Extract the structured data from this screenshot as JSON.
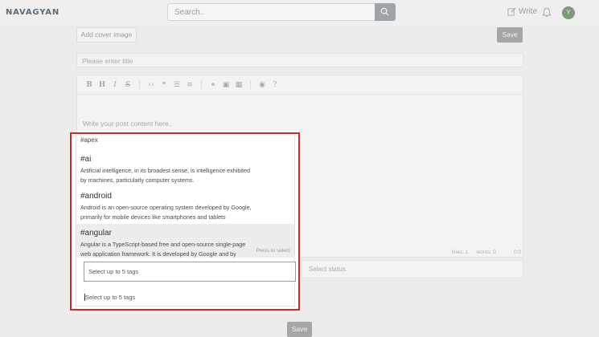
{
  "header": {
    "logo_text": "NAVAGYAN",
    "search_placeholder": "Search..",
    "write_label": "Write",
    "avatar_initial": "Y"
  },
  "editor": {
    "cover_button": "Add cover image",
    "save_top": "Save",
    "title_placeholder": "Please enter title",
    "content_placeholder": "Write your post content here..",
    "status": {
      "lines": "lines: 1",
      "words": "words: 0",
      "cursor": "0:0"
    },
    "status_select_placeholder": "Select status",
    "save_bottom": "Save"
  },
  "tags_dropdown": {
    "options": [
      {
        "title": "#apex"
      },
      {
        "title": "#ai",
        "description": "Artificial intelligence, in its broadest sense, is intelligence exhibited by machines, particularly computer systems."
      },
      {
        "title": "#android",
        "description": "Android is an open-source operating system developed by Google, primarily for mobile devices like smartphones and tablets"
      },
      {
        "title": "#angular",
        "description": "Angular is a TypeScript-based free and open-source single-page web application framework. It is developed by Google and by"
      }
    ],
    "press_hint": "Press to select",
    "tags_box_placeholder": "Select up to 5 tags",
    "tags_input_placeholder": "Select up to 5 tags"
  },
  "colors": {
    "highlight_border": "#d42626",
    "avatar_bg": "#7f9a7b"
  }
}
